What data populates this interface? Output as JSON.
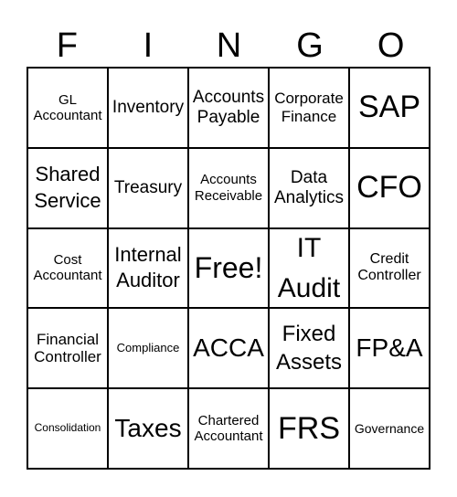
{
  "header": [
    "F",
    "I",
    "N",
    "G",
    "O"
  ],
  "cells": [
    [
      "GL Accountant",
      "Inventory",
      "Accounts Payable",
      "Corporate Finance",
      "SAP"
    ],
    [
      "Shared Service",
      "Treasury",
      "Accounts Receivable",
      "Data Analytics",
      "CFO"
    ],
    [
      "Cost Accountant",
      "Internal Auditor",
      "Free!",
      "IT Audit",
      "Credit Controller"
    ],
    [
      "Financial Controller",
      "Compliance",
      "ACCA",
      "Fixed Assets",
      "FP&A"
    ],
    [
      "Consolidation",
      "Taxes",
      "Chartered Accountant",
      "FRS",
      "Governance"
    ]
  ]
}
